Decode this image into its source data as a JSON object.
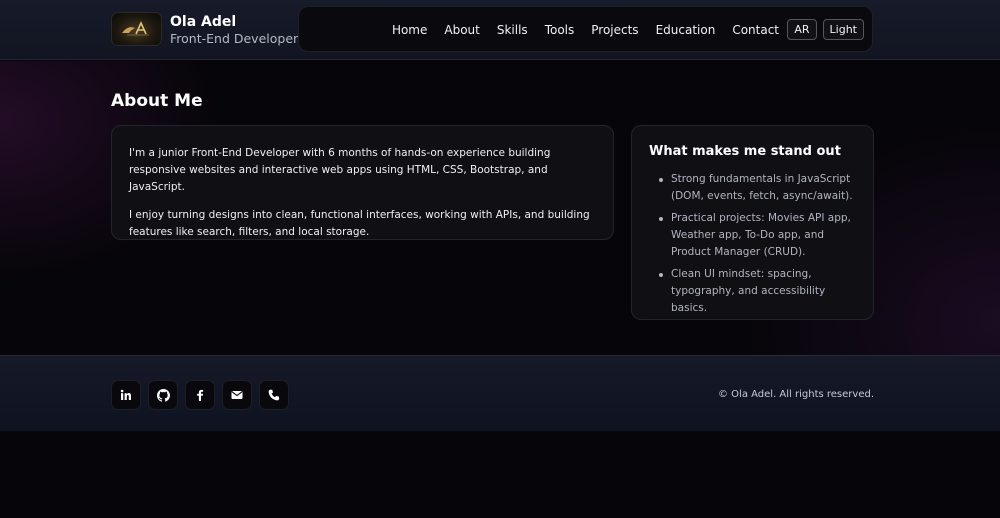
{
  "header": {
    "name": "Ola Adel",
    "role": "Front-End Developer",
    "nav": [
      {
        "label": "Home"
      },
      {
        "label": "About"
      },
      {
        "label": "Skills"
      },
      {
        "label": "Tools"
      },
      {
        "label": "Projects"
      },
      {
        "label": "Education"
      },
      {
        "label": "Contact"
      }
    ],
    "lang_button": "AR",
    "theme_button": "Light"
  },
  "about": {
    "title": "About Me",
    "paragraphs": [
      "I'm a junior Front-End Developer with 6 months of hands-on experience building responsive websites and interactive web apps using HTML, CSS, Bootstrap, and JavaScript.",
      "I enjoy turning designs into clean, functional interfaces, working with APIs, and building features like search, filters, and local storage."
    ]
  },
  "standout": {
    "title": "What makes me stand out",
    "items": [
      "Strong fundamentals in JavaScript (DOM, events, fetch, async/await).",
      "Practical projects: Movies API app, Weather app, To-Do app, and Product Manager (CRUD).",
      "Clean UI mindset: spacing, typography, and accessibility basics."
    ]
  },
  "footer": {
    "social": [
      {
        "icon": "linkedin-icon"
      },
      {
        "icon": "github-icon"
      },
      {
        "icon": "facebook-icon"
      },
      {
        "icon": "email-icon"
      },
      {
        "icon": "phone-icon"
      }
    ],
    "copyright": "© Ola Adel. All rights reserved."
  },
  "colors": {
    "background": "#060509",
    "header": "#171b2a",
    "card": "#0f0f14",
    "text": "#f0f0f4",
    "muted_text": "#b2b4c2"
  }
}
